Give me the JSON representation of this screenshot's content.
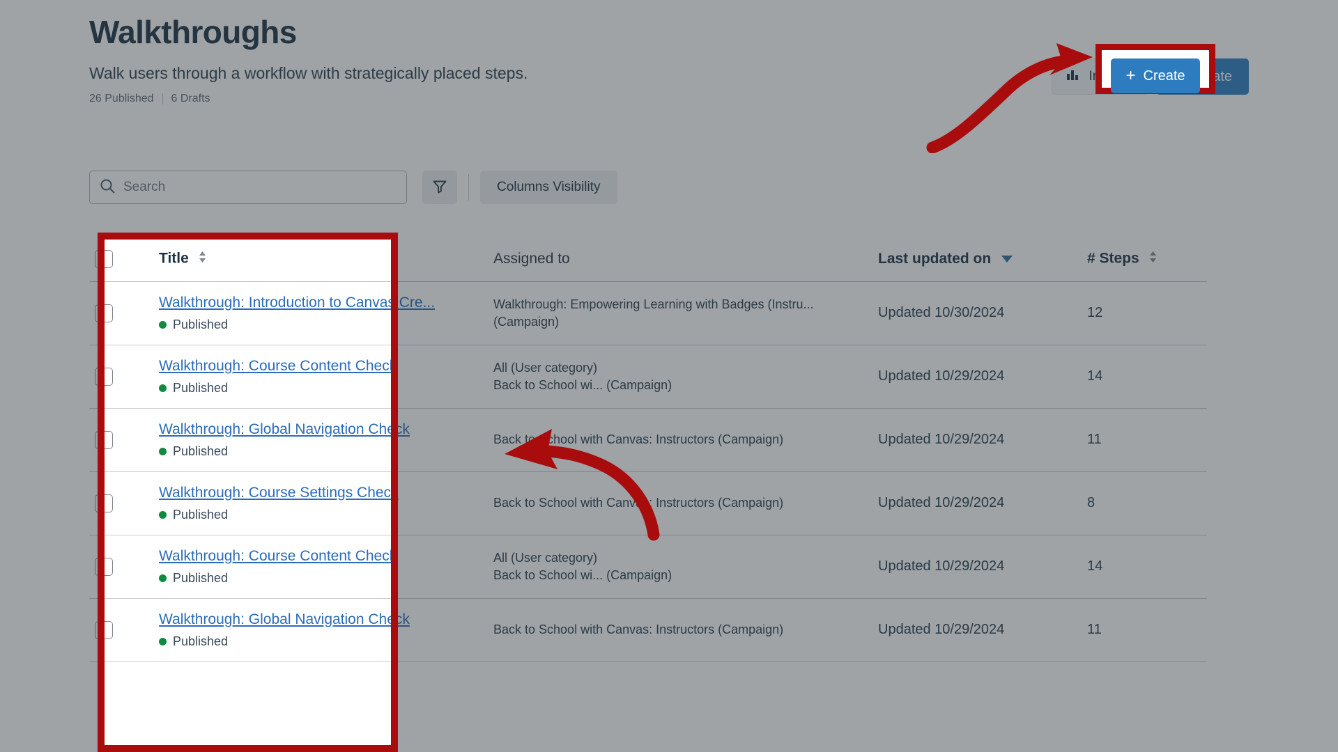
{
  "page": {
    "title": "Walkthroughs",
    "subtitle": "Walk users through a workflow with strategically placed steps.",
    "published_count": "26 Published",
    "drafts_count": "6 Drafts"
  },
  "header_actions": {
    "insights_label": "Insights",
    "create_label": "Create",
    "create_plus": "+",
    "create_color": "#2e7cc0"
  },
  "toolbar": {
    "search_placeholder": "Search",
    "search_value": "",
    "filter_label": "Filter",
    "columns_label": "Columns Visibility"
  },
  "table": {
    "columns": [
      {
        "key": "select",
        "label": ""
      },
      {
        "key": "title",
        "label": "Title",
        "sortable": true,
        "sort_state": "none"
      },
      {
        "key": "assigned",
        "label": "Assigned to",
        "sortable": false
      },
      {
        "key": "updated",
        "label": "Last updated on",
        "sortable": true,
        "sort_state": "desc"
      },
      {
        "key": "steps",
        "label": "# Steps",
        "sortable": true,
        "sort_state": "none"
      }
    ],
    "rows": [
      {
        "title": "Walkthrough: Introduction to Canvas Cre...",
        "status": "Published",
        "status_color": "#0f8a3e",
        "assigned_line1": "Walkthrough: Empowering Learning with Badges (Instru...",
        "assigned_line2": "(Campaign)",
        "updated": "Updated 10/30/2024",
        "steps": "12"
      },
      {
        "title": "Walkthrough: Course Content Check",
        "status": "Published",
        "status_color": "#0f8a3e",
        "assigned_line1": "All (User category)",
        "assigned_line2": "Back to School wi... (Campaign)",
        "updated": "Updated 10/29/2024",
        "steps": "14"
      },
      {
        "title": "Walkthrough: Global Navigation Check",
        "status": "Published",
        "status_color": "#0f8a3e",
        "assigned_line1": "Back to School with Canvas: Instructors (Campaign)",
        "assigned_line2": "",
        "updated": "Updated 10/29/2024",
        "steps": "11"
      },
      {
        "title": "Walkthrough: Course Settings Check",
        "status": "Published",
        "status_color": "#0f8a3e",
        "assigned_line1": "Back to School with Canvas: Instructors (Campaign)",
        "assigned_line2": "",
        "updated": "Updated 10/29/2024",
        "steps": "8"
      },
      {
        "title": "Walkthrough: Course Content Check",
        "status": "Published",
        "status_color": "#0f8a3e",
        "assigned_line1": "All (User category)",
        "assigned_line2": "Back to School wi... (Campaign)",
        "updated": "Updated 10/29/2024",
        "steps": "14"
      },
      {
        "title": "Walkthrough: Global Navigation Check",
        "status": "Published",
        "status_color": "#0f8a3e",
        "assigned_line1": "Back to School with Canvas: Instructors (Campaign)",
        "assigned_line2": "",
        "updated": "Updated 10/29/2024",
        "steps": "11"
      }
    ]
  },
  "annotations": {
    "highlight_color": "#a80c0c",
    "arrow_color": "#a80c0c",
    "boxes": [
      "create-button",
      "title-column"
    ],
    "arrows": [
      "arrow-to-create-button",
      "arrow-to-title-column"
    ]
  }
}
